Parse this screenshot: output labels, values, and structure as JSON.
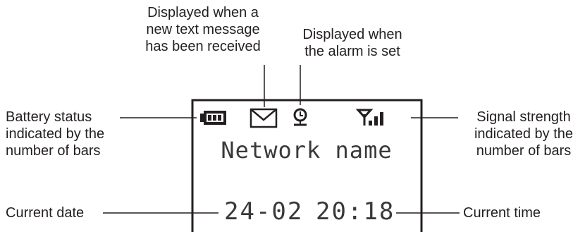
{
  "callouts": {
    "message_icon": "Displayed when a\nnew text message\nhas been received",
    "alarm_icon": "Displayed when\nthe alarm is set",
    "battery": "Battery status\nindicated by the\nnumber of bars",
    "signal": "Signal strength\nindicated by the\nnumber of bars",
    "date": "Current date",
    "time": "Current time"
  },
  "display": {
    "network_name": "Network name",
    "date": "24-02",
    "time": "20:18",
    "battery_bars": 3,
    "signal_bars": 3
  },
  "icons": [
    "battery-icon",
    "envelope-icon",
    "alarm-clock-icon",
    "signal-antenna-icon"
  ]
}
